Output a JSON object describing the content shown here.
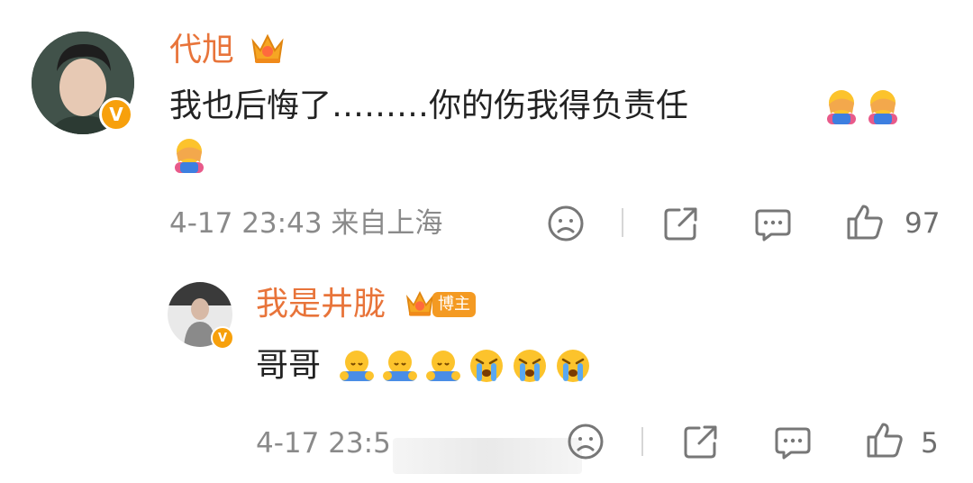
{
  "comment": {
    "author": "代旭",
    "text": "我也后悔了………你的伤我得负责任",
    "emoji_1": "facepalm-emoji",
    "emoji_2": "facepalm-emoji",
    "emoji_3": "facepalm-emoji",
    "meta": "4-17 23:43 来自上海",
    "like_count": "97",
    "verified_mark": "V",
    "crown_icon": "crown-icon"
  },
  "reply": {
    "author": "我是井胧",
    "tag": "博主",
    "text": "哥哥",
    "emoji_list": [
      "hug-emoji",
      "hug-emoji",
      "hug-emoji",
      "crying-emoji",
      "crying-emoji",
      "crying-emoji"
    ],
    "meta_visible": "4-17 23:5",
    "like_count": "5",
    "verified_mark": "V"
  },
  "colors": {
    "name": "#e8743a",
    "badge": "#f7a00c",
    "meta": "#8a8a8a"
  }
}
